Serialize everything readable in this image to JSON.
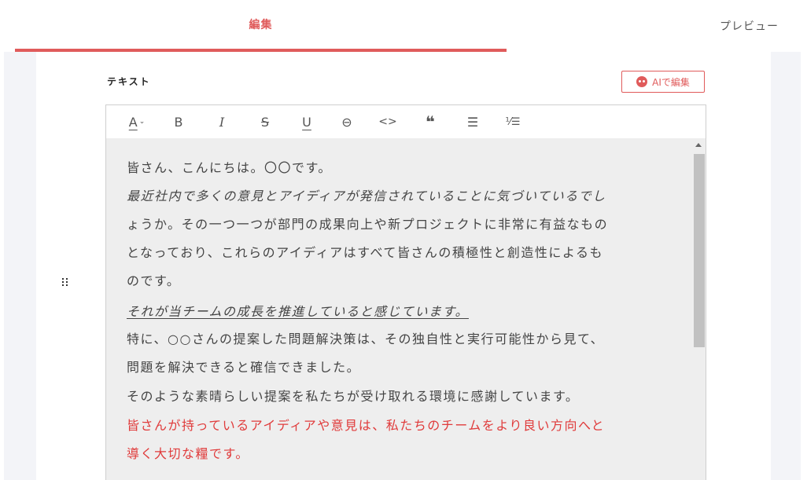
{
  "tabs": {
    "edit": "編集",
    "preview": "プレビュー"
  },
  "field": {
    "label": "テキスト",
    "ai_button": "AIで編集"
  },
  "toolbar": {
    "text_color": "A",
    "bold": "B",
    "italic": "I",
    "strikethrough": "S",
    "underline": "U",
    "link": "⊖",
    "code": "<>",
    "quote": "❝",
    "bullet_list": "☰",
    "ordered_list": "⅟☰"
  },
  "content": {
    "line1": "皆さん、こんにちは。〇〇です。",
    "line2": "最近社内で多くの意見とアイディアが発信されていることに気づいているでし",
    "line3": "ょうか。その一つ一つが部門の成果向上や新プロジェクトに非常に有益なもの",
    "line4": "となっており、これらのアイディアはすべて皆さんの積極性と創造性によるも",
    "line5": "のです。",
    "line6": "それが当チームの成長を推進していると感じています。",
    "line7": "特に、○○さんの提案した問題解決策は、その独自性と実行可能性から見て、",
    "line8": "問題を解決できると確信できました。",
    "line9": "そのような素晴らしい提案を私たちが受け取れる環境に感謝しています。",
    "line10": "皆さんが持っているアイディアや意見は、私たちのチームをより良い方向へと",
    "line11": "導く大切な糧です。"
  },
  "colors": {
    "accent": "#e05b5b",
    "red_text": "#e03b3b",
    "background": "#f3f4f8",
    "editor_bg": "#eeeeee"
  },
  "icons": {
    "ai": "robot-icon",
    "drag": "drag-handle-icon"
  }
}
